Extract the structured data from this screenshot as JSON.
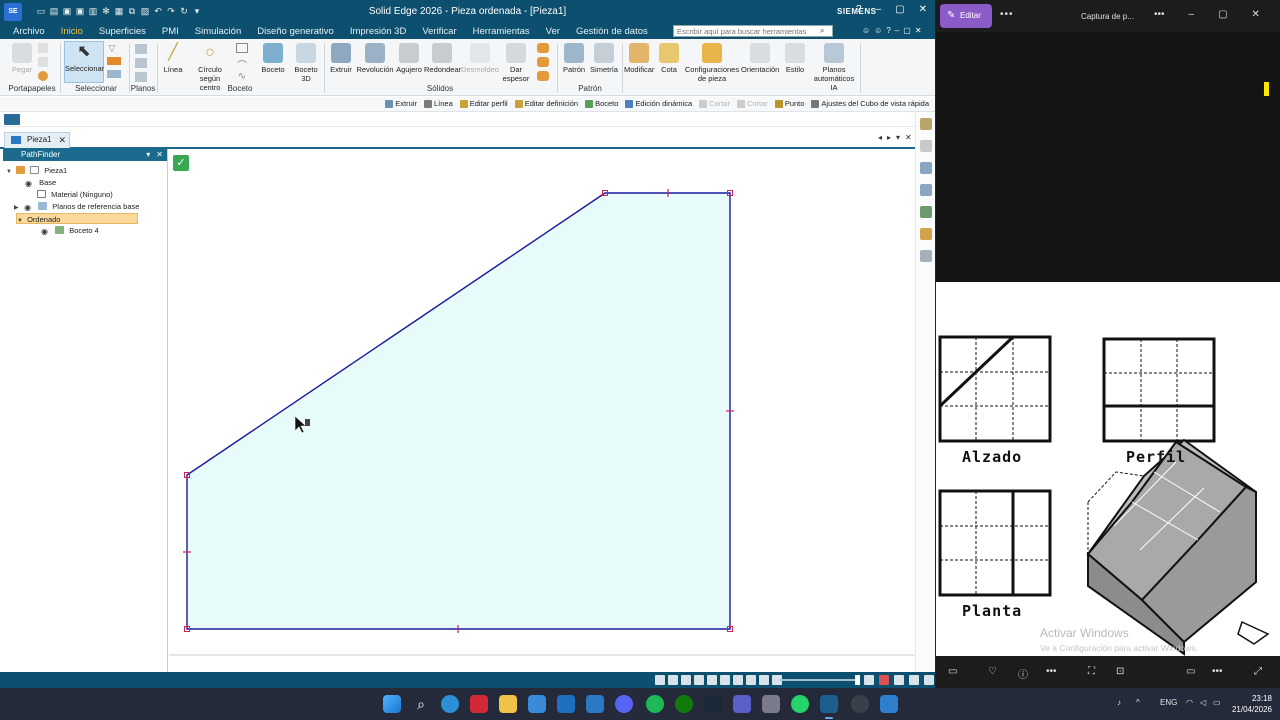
{
  "solid_edge": {
    "logo": "SE",
    "title": "Solid Edge 2026 - Pieza ordenada - [Pieza1]",
    "brand": "SIEMENS",
    "menu_tabs": [
      "Archivo",
      "Inicio",
      "Superficies",
      "PMI",
      "Simulación",
      "Diseño generativo",
      "Impresión 3D",
      "Verificar",
      "Herramientas",
      "Ver",
      "Gestión de datos"
    ],
    "active_tab": "Inicio",
    "search_placeholder": "Escribir aquí para buscar herramientas",
    "ribbon": {
      "pegar": "Pegar",
      "portapapeles": "Portapapeles",
      "seleccionar": "Seleccionar",
      "seleccionar_group": "Seleccionar",
      "planos": "Planos",
      "linea": "Línea",
      "circulo_1": "Círculo según",
      "circulo_2": "centro",
      "boceto_group": "Boceto",
      "boceto": "Boceto",
      "boceto3d_1": "Boceto",
      "boceto3d_2": "3D",
      "extruir": "Extruir",
      "revolucion": "Revolución",
      "agujero": "Agujero",
      "redondear": "Redondear",
      "desmoldeo": "Desmoldeo",
      "dar_espesor_1": "Dar",
      "dar_espesor_2": "espesor",
      "solidos": "Sólidos",
      "patron": "Patrón",
      "simetria": "Simetría",
      "patron_group": "Patrón",
      "modificar": "Modificar",
      "cota": "Cota",
      "config_1": "Configuraciones",
      "config_2": "de pieza",
      "orientacion": "Orientación",
      "estilo": "Estilo",
      "planos_auto_1": "Planos",
      "planos_auto_2": "automáticos",
      "planos_auto_3": "IA"
    },
    "command_bar": [
      {
        "label": "Extruir",
        "enabled": true,
        "color": "#6c8fb3"
      },
      {
        "label": "Línea",
        "enabled": true,
        "color": "#7a7a7a"
      },
      {
        "label": "Editar perfil",
        "enabled": true,
        "color": "#c8a33a"
      },
      {
        "label": "Editar definición",
        "enabled": true,
        "color": "#c8a33a"
      },
      {
        "label": "Boceto",
        "enabled": true,
        "color": "#5a9c5a"
      },
      {
        "label": "Edición dinámica",
        "enabled": true,
        "color": "#4a7fc1"
      },
      {
        "label": "Cortar",
        "enabled": false,
        "color": "#cccccc"
      },
      {
        "label": "Cortar",
        "enabled": false,
        "color": "#cccccc"
      },
      {
        "label": "Punto",
        "enabled": true,
        "color": "#b8952a"
      },
      {
        "label": "Ajustes del Cubo de vista rápida",
        "enabled": true,
        "color": "#777777"
      }
    ],
    "doc_tab": "Pieza1",
    "pathfinder": {
      "title": "PathFinder",
      "items": [
        {
          "label": "Pieza1"
        },
        {
          "label": "Base"
        },
        {
          "label": "Material (Ninguno)"
        },
        {
          "label": "Planos de referencia base"
        },
        {
          "label": "Ordenado"
        },
        {
          "label": "Boceto 4"
        }
      ]
    },
    "canvas": {
      "accept_icon": "✓",
      "sketch_fill": "#e8fbfb",
      "sketch_stroke": "#1a1a9c",
      "handle_color": "#d02060"
    }
  },
  "snipping": {
    "edit_label": "Editar",
    "title": "Captura de p...",
    "views": [
      "Alzado",
      "Perfil",
      "Planta"
    ],
    "watermark_title": "Activar Windows",
    "watermark_sub": "Ve a Configuración para activar Windows."
  },
  "taskbar": {
    "language": "ENG",
    "time": "23:18",
    "date": "21/04/2026"
  }
}
